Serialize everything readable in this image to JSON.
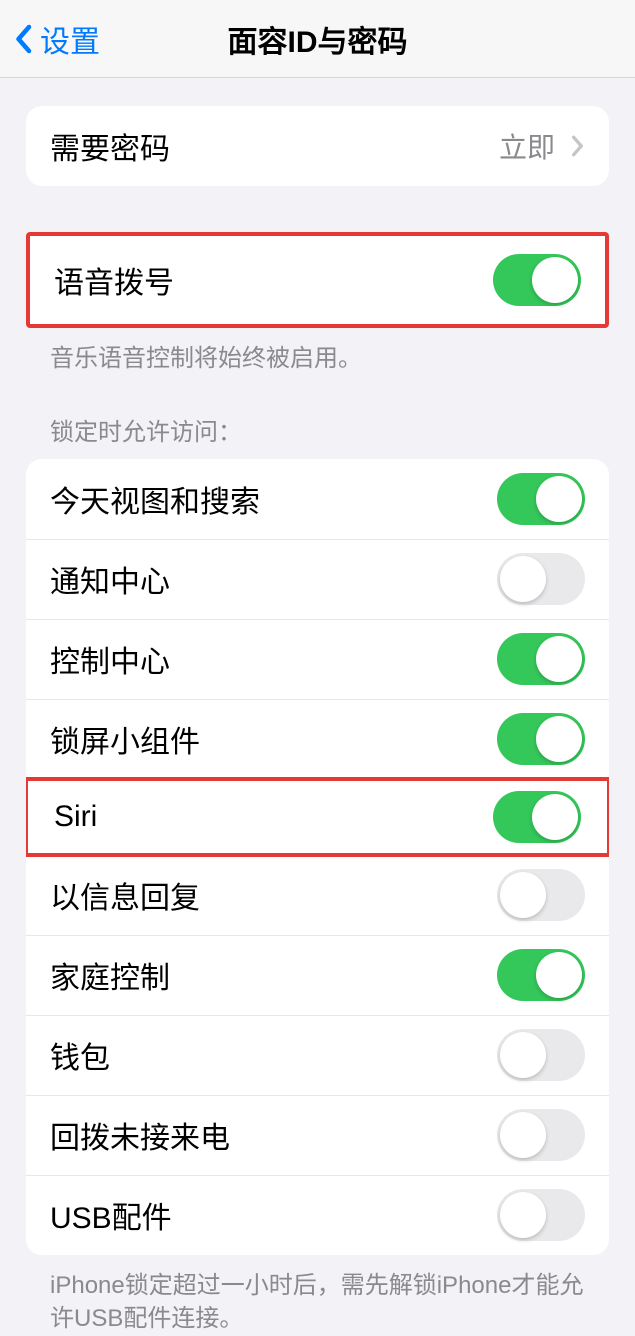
{
  "nav": {
    "back_label": "设置",
    "title": "面容ID与密码"
  },
  "passcode_row": {
    "label": "需要密码",
    "value": "立即"
  },
  "voice_dial": {
    "label": "语音拨号",
    "on": true,
    "footer": "音乐语音控制将始终被启用。"
  },
  "lock_access": {
    "header": "锁定时允许访问：",
    "items": [
      {
        "label": "今天视图和搜索",
        "on": true,
        "highlighted": false
      },
      {
        "label": "通知中心",
        "on": false,
        "highlighted": false
      },
      {
        "label": "控制中心",
        "on": true,
        "highlighted": false
      },
      {
        "label": "锁屏小组件",
        "on": true,
        "highlighted": false
      },
      {
        "label": "Siri",
        "on": true,
        "highlighted": true
      },
      {
        "label": "以信息回复",
        "on": false,
        "highlighted": false
      },
      {
        "label": "家庭控制",
        "on": true,
        "highlighted": false
      },
      {
        "label": "钱包",
        "on": false,
        "highlighted": false
      },
      {
        "label": "回拨未接来电",
        "on": false,
        "highlighted": false
      },
      {
        "label": "USB配件",
        "on": false,
        "highlighted": false
      }
    ],
    "footer": "iPhone锁定超过一小时后，需先解锁iPhone才能允许USB配件连接。"
  }
}
